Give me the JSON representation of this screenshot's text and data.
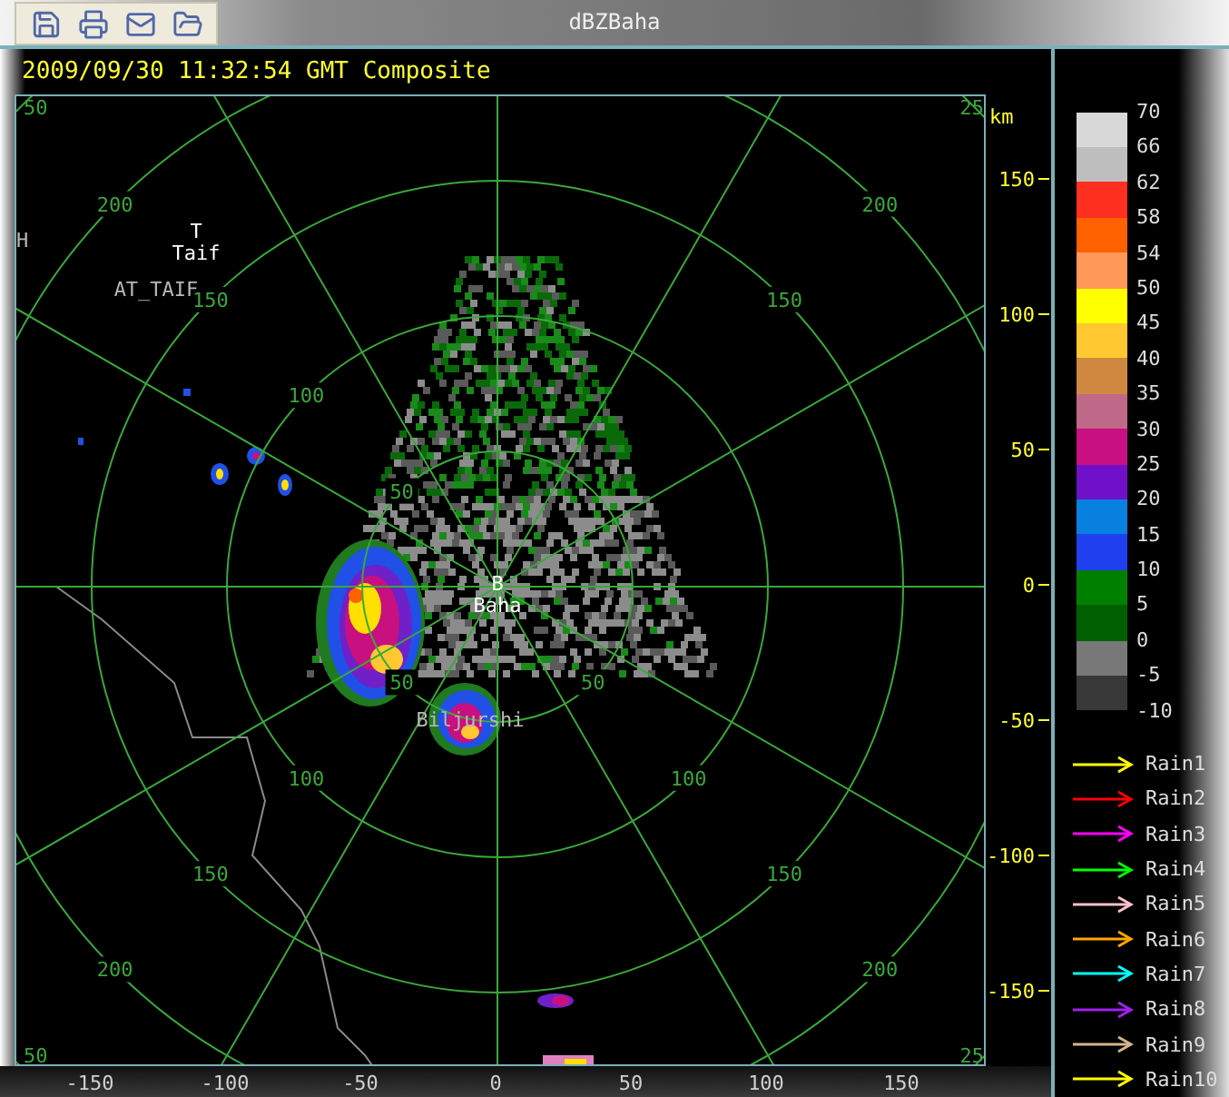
{
  "window": {
    "title": "dBZBaha"
  },
  "toolbar": {
    "buttons": [
      {
        "kind": "save"
      },
      {
        "kind": "print"
      },
      {
        "kind": "mail"
      },
      {
        "kind": "folder"
      }
    ]
  },
  "header": {
    "timestamp": "2009/09/30 11:32:54 GMT Composite"
  },
  "plot": {
    "ring_labels": [
      {
        "nw": "50",
        "sw": "50",
        "se": "50"
      },
      {
        "nw": "100",
        "sw": "100",
        "se": "100"
      },
      {
        "nw": "150",
        "ne": "150",
        "sw": "150",
        "se": "150"
      },
      {
        "nw": "200",
        "ne": "200",
        "sw": "200",
        "se": "200"
      }
    ],
    "corner_labels": {
      "nw": "50",
      "ne": "25",
      "sw": "50",
      "se": "25"
    },
    "places": [
      {
        "kind": "station",
        "symbol": "T",
        "name": "Taif"
      },
      {
        "kind": "site",
        "name": "AT_TAIF"
      },
      {
        "kind": "site",
        "name": "H"
      },
      {
        "kind": "station",
        "symbol": "B",
        "name": "Baha"
      },
      {
        "kind": "site",
        "name": "Biljurshi"
      }
    ]
  },
  "y_axis": {
    "unit": "km",
    "ticks": [
      "150",
      "100",
      "50",
      "0",
      "-50",
      "-100",
      "-150"
    ]
  },
  "x_axis": {
    "ticks": [
      "-150",
      "-100",
      "-50",
      "0",
      "50",
      "100",
      "150"
    ]
  },
  "legend": {
    "labels": [
      "70",
      "66",
      "62",
      "58",
      "54",
      "50",
      "45",
      "40",
      "35",
      "30",
      "25",
      "20",
      "15",
      "10",
      "5",
      "0",
      "-5",
      "-10"
    ],
    "bands": [
      {
        "color": "#d8d8d8"
      },
      {
        "color": "#bebebe"
      },
      {
        "color": "#ff3020"
      },
      {
        "color": "#ff6000"
      },
      {
        "color": "#ff9858"
      },
      {
        "color": "#ffff00"
      },
      {
        "color": "#ffc830"
      },
      {
        "color": "#d08840"
      },
      {
        "color": "#c06888"
      },
      {
        "color": "#c81080"
      },
      {
        "color": "#7010c8"
      },
      {
        "color": "#0880e0"
      },
      {
        "color": "#2040f0"
      },
      {
        "color": "#008000"
      },
      {
        "color": "#006000"
      },
      {
        "color": "#787878"
      },
      {
        "color": "#383838"
      }
    ]
  },
  "tracks": [
    {
      "label": "Rain1",
      "color": "#ffff00"
    },
    {
      "label": "Rain2",
      "color": "#ff0000"
    },
    {
      "label": "Rain3",
      "color": "#ff00ff"
    },
    {
      "label": "Rain4",
      "color": "#00ff00"
    },
    {
      "label": "Rain5",
      "color": "#ffc0cb"
    },
    {
      "label": "Rain6",
      "color": "#ffa500"
    },
    {
      "label": "Rain7",
      "color": "#00ffff"
    },
    {
      "label": "Rain8",
      "color": "#a020f0"
    },
    {
      "label": "Rain9",
      "color": "#d2b48c"
    },
    {
      "label": "Rain10",
      "color": "#ffff00"
    }
  ]
}
